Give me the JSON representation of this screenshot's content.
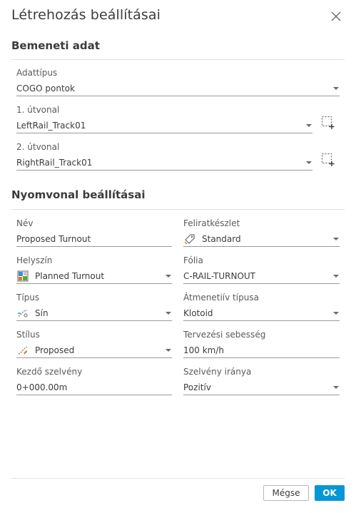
{
  "dialog": {
    "title": "Létrehozás beállításai"
  },
  "input_section": {
    "title": "Bemeneti adat",
    "data_type": {
      "label": "Adattípus",
      "value": "COGO pontok"
    },
    "path1": {
      "label": "1. útvonal",
      "value": "LeftRail_Track01"
    },
    "path2": {
      "label": "2. útvonal",
      "value": "RightRail_Track01"
    }
  },
  "track_section": {
    "title": "Nyomvonal beállításai",
    "name": {
      "label": "Név",
      "value": "Proposed Turnout"
    },
    "label_set": {
      "label": "Feliratkészlet",
      "value": "Standard",
      "icon": "label-set-icon"
    },
    "site": {
      "label": "Helyszín",
      "value": "Planned Turnout",
      "icon": "site-icon"
    },
    "layer": {
      "label": "Fólia",
      "value": "C-RAIL-TURNOUT"
    },
    "type": {
      "label": "Típus",
      "value": "Sín",
      "icon": "rail-type-icon"
    },
    "transition_type": {
      "label": "Átmenetiív típusa",
      "value": "Klotoid"
    },
    "style": {
      "label": "Stílus",
      "value": "Proposed",
      "icon": "style-icon"
    },
    "design_speed": {
      "label": "Tervezési sebesség",
      "value": "100 km/h"
    },
    "start_station": {
      "label": "Kezdő szelvény",
      "value": "0+000.00m"
    },
    "station_direction": {
      "label": "Szelvény iránya",
      "value": "Pozitív"
    }
  },
  "footer": {
    "cancel_label": "Mégse",
    "ok_label": "OK"
  },
  "colors": {
    "accent": "#0696d7",
    "divider": "#e2e2e2",
    "text": "#3c3c3c"
  }
}
